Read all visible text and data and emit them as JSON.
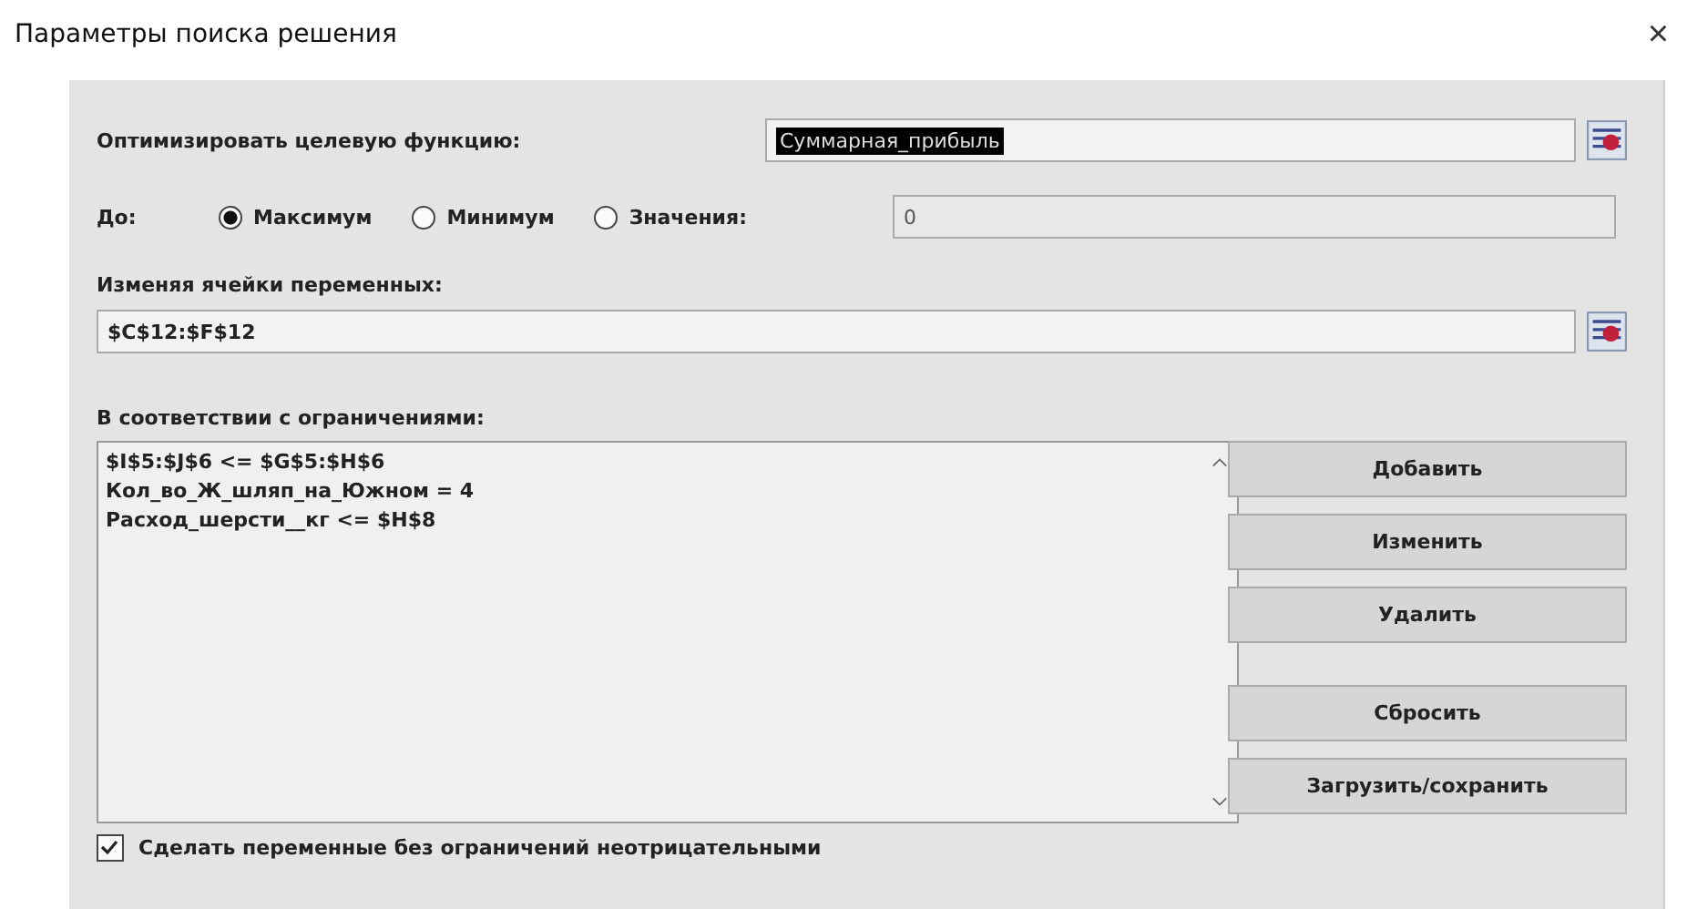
{
  "window": {
    "title": "Параметры поиска решения",
    "close": "×"
  },
  "objective": {
    "label": "Оптимизировать целевую функцию:",
    "value": "Суммарная_прибыль",
    "value_selected": true
  },
  "to": {
    "label": "До:",
    "options": [
      {
        "label": "Максимум",
        "selected": true
      },
      {
        "label": "Минимум",
        "selected": false
      },
      {
        "label": "Значения:",
        "selected": false
      }
    ],
    "value": "0",
    "value_disabled": true
  },
  "variables": {
    "label": "Изменяя ячейки переменных:",
    "value": "$C$12:$F$12"
  },
  "constraints": {
    "label": "В соответствии с ограничениями:",
    "items": [
      "$I$5:$J$6 <= $G$5:$H$6",
      "Кол_во_Ж_шляп_на_Южном = 4",
      "Расход_шерсти__кг <= $H$8"
    ]
  },
  "button_groups": [
    [
      "Добавить",
      "Изменить",
      "Удалить"
    ],
    [
      "Сбросить",
      "Загрузить/сохранить"
    ]
  ],
  "nonnegative": {
    "label": "Сделать переменные без ограничений неотрицательными",
    "checked": true
  }
}
